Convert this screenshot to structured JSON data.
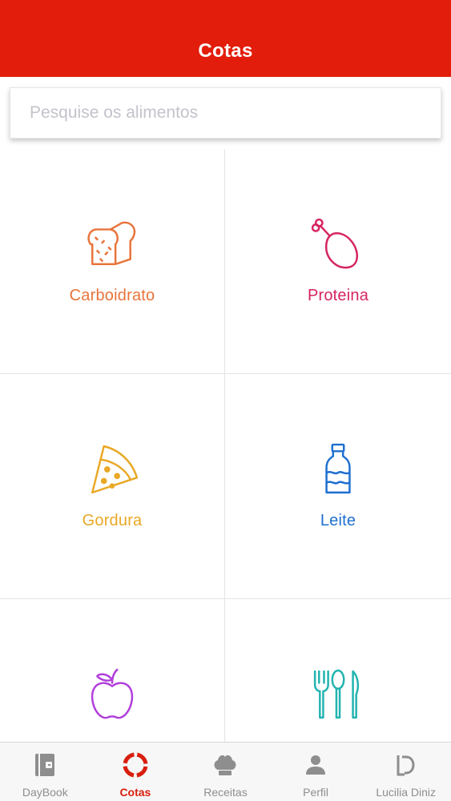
{
  "header": {
    "title": "Cotas"
  },
  "search": {
    "placeholder": "Pesquise os alimentos"
  },
  "categories": [
    {
      "label": "Carboidrato",
      "icon": "bread-icon",
      "color": "#e8743b"
    },
    {
      "label": "Proteina",
      "icon": "chicken-leg-icon",
      "color": "#d6245f"
    },
    {
      "label": "Gordura",
      "icon": "pizza-slice-icon",
      "color": "#e9a825"
    },
    {
      "label": "Leite",
      "icon": "milk-bottle-icon",
      "color": "#1e6fd0"
    },
    {
      "label": "",
      "icon": "apple-icon",
      "color": "#b13fdc"
    },
    {
      "label": "",
      "icon": "cutlery-icon",
      "color": "#21b3b0"
    }
  ],
  "tabs": [
    {
      "label": "DayBook",
      "icon": "book-icon"
    },
    {
      "label": "Cotas",
      "icon": "lifebuoy-icon",
      "active": true
    },
    {
      "label": "Receitas",
      "icon": "chef-hat-icon"
    },
    {
      "label": "Perfil",
      "icon": "person-icon"
    },
    {
      "label": "Lucilia Diniz",
      "icon": "ld-logo-icon"
    }
  ],
  "colors": {
    "accent": "#e21d0b",
    "tab_inactive": "#8e8e8e",
    "tab_active": "#d81e0e"
  }
}
